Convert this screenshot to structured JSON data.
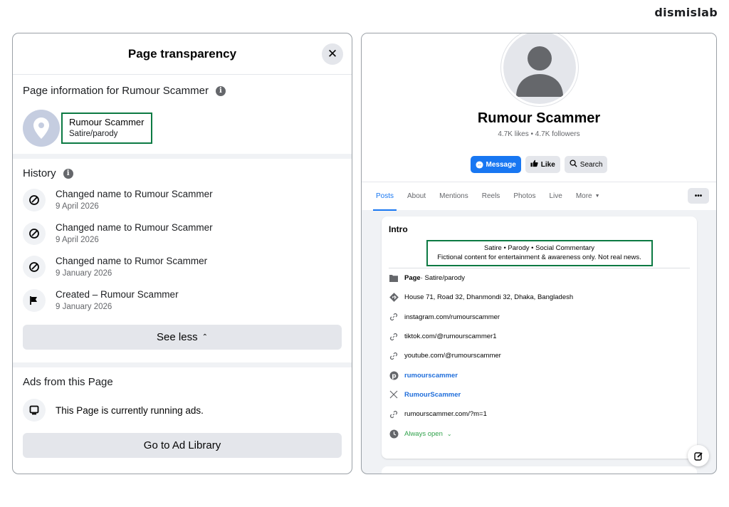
{
  "brand": "dismislab",
  "transparency": {
    "title": "Page transparency",
    "page_info_title": "Page information for Rumour Scammer",
    "page_name": "Rumour Scammer",
    "page_category": "Satire/parody",
    "history_title": "History",
    "history": [
      {
        "text": "Changed name to Rumour Scammer",
        "date": "9 April 2026",
        "icon": "rename-icon"
      },
      {
        "text": "Changed name to Rumour Scammer",
        "date": "9 April 2026",
        "icon": "rename-icon"
      },
      {
        "text": "Changed name to Rumor Scammer",
        "date": "9 January 2026",
        "icon": "rename-icon"
      },
      {
        "text": "Created – Rumour Scammer",
        "date": "9 January 2026",
        "icon": "flag-icon"
      }
    ],
    "see_less": "See less",
    "ads_title": "Ads from this Page",
    "ads_status": "This Page is currently running ads.",
    "ad_library": "Go to Ad Library"
  },
  "profile": {
    "name": "Rumour Scammer",
    "stats": "4.7K likes • 4.7K followers",
    "actions": {
      "message": "Message",
      "like": "Like",
      "search": "Search"
    },
    "tabs": [
      "Posts",
      "About",
      "Mentions",
      "Reels",
      "Photos",
      "Live",
      "More"
    ],
    "active_tab": "Posts",
    "more_dots": "•••",
    "intro": {
      "title": "Intro",
      "bio_line1": "Satire • Parody • Social Commentary",
      "bio_line2": "Fictional content for entertainment & awareness only. Not real news.",
      "page_label": "Page",
      "page_category": " · Satire/parody",
      "address": "House 71, Road 32, Dhanmondi 32, Dhaka, Bangladesh",
      "links": [
        "instagram.com/rumourscammer",
        "tiktok.com/@rumourscammer1",
        "youtube.com/@rumourscammer"
      ],
      "pinterest": "rumourscammer",
      "x_handle": "RumourScammer",
      "website": "rumourscammer.com/?m=1",
      "hours": "Always open"
    }
  },
  "colors": {
    "accent": "#1877f2",
    "highlight_box": "#0c7a43",
    "open_green": "#31a24c"
  }
}
